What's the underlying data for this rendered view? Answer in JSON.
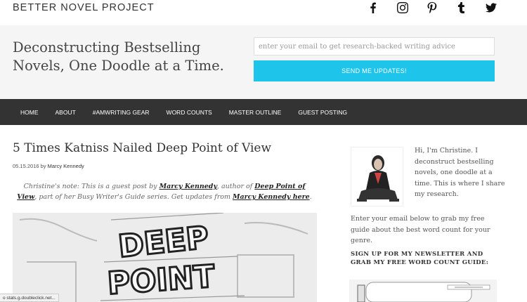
{
  "site": {
    "title": "BETTER NOVEL PROJECT"
  },
  "social": [
    {
      "name": "facebook-icon"
    },
    {
      "name": "instagram-icon"
    },
    {
      "name": "pinterest-icon"
    },
    {
      "name": "tumblr-icon"
    },
    {
      "name": "twitter-icon"
    }
  ],
  "hero": {
    "tagline": "Deconstructing Bestselling Novels, One Doodle at a Time.",
    "email_placeholder": "enter your email to get research-backed writing advice",
    "button_label": "SEND ME UPDATES!"
  },
  "nav": [
    {
      "label": "HOME"
    },
    {
      "label": "ABOUT"
    },
    {
      "label": "#AMWRITING GEAR"
    },
    {
      "label": "WORD COUNTS"
    },
    {
      "label": "MASTER OUTLINE"
    },
    {
      "label": "GUEST POSTING"
    }
  ],
  "article": {
    "title": "5 Times Katniss Nailed Deep Point of View",
    "date": "05.15.2016",
    "by": "by",
    "author": "Marcy Kennedy",
    "note_prefix": "Christine's note: This is a guest post by",
    "note_author": "Marcy Kennedy",
    "note_mid": ", author of",
    "note_book": "Deep Point of View",
    "note_after_book": ", part of her Busy Writer's Guide series. Get updates from",
    "note_link": "Marcy Kennedy here",
    "note_end": "."
  },
  "sidebar": {
    "intro": "Hi, I'm Christine. I deconstruct bestselling novels, one doodle at a time. This is where I share my research.",
    "guide_text": "Enter your email below to grab my free guide about the best word count for your genre.",
    "newsletter_heading": "SIGN UP FOR MY NEWSLETTER AND GRAB MY FREE WORD COUNT GUIDE:"
  },
  "status": {
    "text": "o stats.g.doubleclick.net..."
  },
  "colors": {
    "accent": "#1ec4ea",
    "nav_bg": "#333333",
    "hero_bg": "#f5f5f5"
  }
}
